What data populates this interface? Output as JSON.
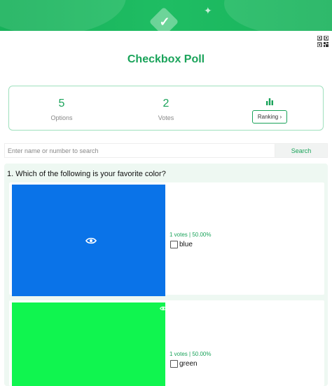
{
  "header": {
    "check_icon": "check-icon",
    "sparkle_icon": "sparkle-icon",
    "brand_color": "#1aa35a"
  },
  "poll": {
    "title": "Checkbox Poll"
  },
  "stats": {
    "options_count": "5",
    "options_label": "Options",
    "votes_count": "2",
    "votes_label": "Votes",
    "ranking_label": "Ranking"
  },
  "search": {
    "placeholder": "Enter name or number to search",
    "button_label": "Search"
  },
  "question": {
    "text": "1. Which of the following is your favorite color?",
    "options": [
      {
        "label": "blue",
        "stats": "1 votes | 50.00%",
        "color": "#0a73e8"
      },
      {
        "label": "green",
        "stats": "1 votes | 50.00%",
        "color": "#10f54f"
      }
    ]
  }
}
